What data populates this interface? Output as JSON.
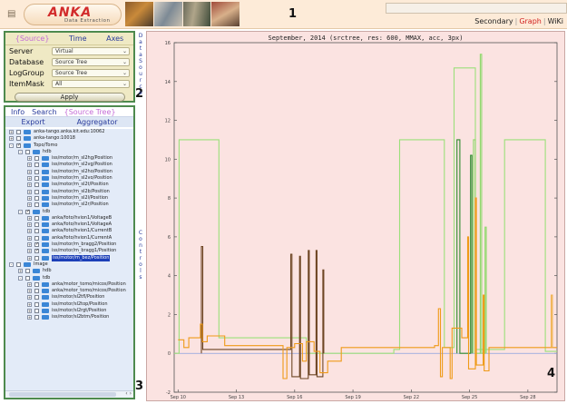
{
  "header": {
    "logo_text": "ANKA",
    "logo_subtitle": "Data Extraction",
    "view_links": [
      {
        "label": "Secondary",
        "active": false
      },
      {
        "label": "Graph",
        "active": true
      },
      {
        "label": "WiKi",
        "active": false
      }
    ]
  },
  "markers": [
    "1",
    "2",
    "3",
    "4"
  ],
  "source_panel": {
    "tabs": [
      {
        "label": "{Source}",
        "selected": true
      },
      {
        "label": "Time",
        "selected": false
      },
      {
        "label": "Axes",
        "selected": false
      }
    ],
    "fields": [
      {
        "label": "Server",
        "value": "Virtual"
      },
      {
        "label": "Database",
        "value": "Source Tree"
      },
      {
        "label": "LogGroup",
        "value": "Source Tree"
      },
      {
        "label": "ItemMask",
        "value": "All"
      }
    ],
    "apply_label": "Apply",
    "strip_label": "Data Source"
  },
  "tree_panel": {
    "tabs_row1": [
      {
        "label": "Info",
        "selected": false
      },
      {
        "label": "Search",
        "selected": false
      },
      {
        "label": "{Source Tree}",
        "selected": true
      }
    ],
    "tabs_row2": [
      {
        "label": "Export",
        "selected": false
      },
      {
        "label": "Aggregator",
        "selected": false
      }
    ],
    "controls_strip": "Controls",
    "scroll_glyph": "‹ ›",
    "items": [
      {
        "level": 0,
        "toggle": "+",
        "checked": false,
        "label": "anka-tango.anka.kit.edu:10062"
      },
      {
        "level": 0,
        "toggle": "+",
        "checked": false,
        "label": "anka-tango:10018"
      },
      {
        "level": 0,
        "toggle": "-",
        "checked": true,
        "label": "Topo/Tomo"
      },
      {
        "level": 1,
        "toggle": "-",
        "checked": false,
        "label": "hdb"
      },
      {
        "level": 2,
        "toggle": "+",
        "checked": false,
        "label": "iss/motor/m_sl2hg/Position"
      },
      {
        "level": 2,
        "toggle": "+",
        "checked": false,
        "label": "iss/motor/m_sl2vg/Position"
      },
      {
        "level": 2,
        "toggle": "+",
        "checked": false,
        "label": "iss/motor/m_sl2ho/Position"
      },
      {
        "level": 2,
        "toggle": "+",
        "checked": false,
        "label": "iss/motor/m_sl2vo/Position"
      },
      {
        "level": 2,
        "toggle": "+",
        "checked": false,
        "label": "iss/motor/m_sl2t/Position"
      },
      {
        "level": 2,
        "toggle": "+",
        "checked": false,
        "label": "iss/motor/m_sl2b/Position"
      },
      {
        "level": 2,
        "toggle": "+",
        "checked": false,
        "label": "iss/motor/m_sl2l/Position"
      },
      {
        "level": 2,
        "toggle": "+",
        "checked": false,
        "label": "iss/motor/m_sl2r/Position"
      },
      {
        "level": 1,
        "toggle": "-",
        "checked": true,
        "label": "tdb"
      },
      {
        "level": 2,
        "toggle": "+",
        "checked": false,
        "label": "anka/foto/hvion1/VoltageB"
      },
      {
        "level": 2,
        "toggle": "+",
        "checked": false,
        "label": "anka/foto/hvion1/VoltageA"
      },
      {
        "level": 2,
        "toggle": "+",
        "checked": false,
        "label": "anka/foto/hvion1/CurrentB"
      },
      {
        "level": 2,
        "toggle": "+",
        "checked": false,
        "label": "anka/foto/hvion1/CurrentA"
      },
      {
        "level": 2,
        "toggle": "+",
        "checked": true,
        "label": "iss/motor/m_bragg2/Position"
      },
      {
        "level": 2,
        "toggle": "+",
        "checked": true,
        "label": "iss/motor/m_bragg1/Position"
      },
      {
        "level": 2,
        "toggle": "+",
        "checked": false,
        "label": "iss/motor/m_bez/Position",
        "highlighted": true
      },
      {
        "level": 0,
        "toggle": "-",
        "checked": false,
        "label": "Image"
      },
      {
        "level": 1,
        "toggle": "+",
        "checked": false,
        "label": "hdb"
      },
      {
        "level": 1,
        "toggle": "-",
        "checked": false,
        "label": "tdb"
      },
      {
        "level": 2,
        "toggle": "+",
        "checked": false,
        "label": "anka/motor_tomo/micos/Position"
      },
      {
        "level": 2,
        "toggle": "+",
        "checked": false,
        "label": "anka/motor_tomo/micos/Position"
      },
      {
        "level": 2,
        "toggle": "+",
        "checked": false,
        "label": "iss/motor/sl2tfl/Position"
      },
      {
        "level": 2,
        "toggle": "+",
        "checked": false,
        "label": "iss/motor/sl2top/Position"
      },
      {
        "level": 2,
        "toggle": "+",
        "checked": false,
        "label": "iss/motor/sl2rgt/Position"
      },
      {
        "level": 2,
        "toggle": "+",
        "checked": false,
        "label": "iss/motor/sl2btm/Position"
      }
    ]
  },
  "chart_data": {
    "type": "line",
    "title": "September, 2014 (srctree, res: 600, MMAX, acc, 3px)",
    "xlabel": "",
    "ylabel": "",
    "x_ticks": [
      "Sep 10",
      "Sep 13",
      "Sep 16",
      "Sep 19",
      "Sep 22",
      "Sep 25",
      "Sep 28"
    ],
    "x_tick_days": [
      10,
      13,
      16,
      19,
      22,
      25,
      28
    ],
    "xlim": [
      9.8,
      29.5
    ],
    "y_ticks": [
      -2,
      0,
      2,
      4,
      6,
      8,
      10,
      12,
      14,
      16
    ],
    "ylim": [
      -2,
      16
    ],
    "grid": false,
    "series": [
      {
        "color": "#9be07a",
        "points": [
          [
            9.8,
            0
          ],
          [
            10.05,
            0
          ],
          [
            10.05,
            11
          ],
          [
            12.1,
            11
          ],
          [
            12.1,
            0.8
          ],
          [
            16.6,
            0.8
          ],
          [
            16.6,
            0
          ],
          [
            21.1,
            0
          ],
          [
            21.1,
            0.2
          ],
          [
            21.4,
            0.2
          ],
          [
            21.4,
            11
          ],
          [
            23.7,
            11
          ],
          [
            23.7,
            0.3
          ],
          [
            24.2,
            0.3
          ],
          [
            24.2,
            14.7
          ],
          [
            25.3,
            14.7
          ],
          [
            25.3,
            0.2
          ],
          [
            26.8,
            0.2
          ],
          [
            26.8,
            11
          ],
          [
            28.9,
            11
          ],
          [
            28.9,
            0.1
          ],
          [
            29.5,
            0.1
          ]
        ]
      },
      {
        "color": "#2e8b2e",
        "points": [
          [
            24.35,
            0
          ],
          [
            24.35,
            11
          ],
          [
            24.5,
            11
          ],
          [
            24.5,
            0
          ],
          [
            25.05,
            0
          ],
          [
            25.05,
            10.2
          ],
          [
            25.12,
            10.2
          ],
          [
            25.12,
            0
          ]
        ]
      },
      {
        "color": "#8fd96a",
        "points": [
          [
            25.2,
            0
          ],
          [
            25.2,
            11
          ],
          [
            25.3,
            11
          ],
          [
            25.3,
            0
          ],
          [
            25.55,
            0
          ],
          [
            25.55,
            15.4
          ],
          [
            25.62,
            15.4
          ],
          [
            25.62,
            0
          ],
          [
            25.8,
            0
          ],
          [
            25.8,
            6.5
          ],
          [
            25.86,
            6.5
          ],
          [
            25.86,
            0
          ]
        ]
      },
      {
        "color": "#6e4624",
        "points": [
          [
            11.2,
            0
          ],
          [
            11.2,
            5.5
          ],
          [
            11.27,
            5.5
          ],
          [
            11.27,
            0.2
          ],
          [
            15.8,
            0.2
          ],
          [
            15.8,
            5.1
          ],
          [
            15.86,
            5.1
          ],
          [
            15.86,
            -1.2
          ],
          [
            16.25,
            -1.2
          ],
          [
            16.25,
            5.0
          ],
          [
            16.3,
            5.0
          ],
          [
            16.3,
            -1.3
          ],
          [
            16.7,
            -1.3
          ],
          [
            16.7,
            5.3
          ],
          [
            16.75,
            5.3
          ],
          [
            16.75,
            -1.1
          ],
          [
            17.1,
            -1.1
          ],
          [
            17.1,
            5.3
          ],
          [
            17.15,
            5.3
          ],
          [
            17.15,
            -1.2
          ],
          [
            17.45,
            -1.2
          ],
          [
            17.45,
            4.3
          ],
          [
            17.5,
            4.3
          ],
          [
            17.5,
            0
          ]
        ]
      },
      {
        "color": "#ef9a18",
        "points": [
          [
            10.0,
            0.7
          ],
          [
            10.3,
            0.7
          ],
          [
            10.3,
            0.3
          ],
          [
            10.55,
            0.3
          ],
          [
            10.55,
            0.8
          ],
          [
            11.15,
            0.8
          ],
          [
            11.15,
            1.5
          ],
          [
            11.25,
            1.5
          ],
          [
            11.25,
            0.6
          ],
          [
            11.5,
            0.6
          ],
          [
            11.5,
            0.9
          ],
          [
            12.4,
            0.9
          ],
          [
            12.4,
            0.4
          ],
          [
            15.4,
            0.4
          ],
          [
            15.4,
            -1.3
          ],
          [
            15.6,
            -1.3
          ],
          [
            15.6,
            0.3
          ],
          [
            16.0,
            0.3
          ],
          [
            16.0,
            0.5
          ],
          [
            16.4,
            0.5
          ],
          [
            16.4,
            -0.4
          ],
          [
            16.6,
            -0.4
          ],
          [
            16.6,
            0.6
          ],
          [
            17.0,
            0.6
          ],
          [
            17.0,
            0.1
          ],
          [
            17.3,
            0.1
          ],
          [
            17.3,
            -1.0
          ],
          [
            17.7,
            -1.0
          ],
          [
            17.7,
            -0.4
          ],
          [
            18.4,
            -0.4
          ],
          [
            18.4,
            0.3
          ],
          [
            23.2,
            0.3
          ],
          [
            23.2,
            0.4
          ],
          [
            23.4,
            0.4
          ],
          [
            23.4,
            2.3
          ],
          [
            23.5,
            2.3
          ],
          [
            23.5,
            -1.2
          ],
          [
            23.6,
            -1.2
          ],
          [
            23.6,
            0.3
          ],
          [
            24.0,
            0.3
          ],
          [
            24.0,
            -1.3
          ],
          [
            24.1,
            -1.3
          ],
          [
            24.1,
            1.3
          ],
          [
            24.6,
            1.3
          ],
          [
            24.6,
            0.8
          ],
          [
            24.9,
            0.8
          ],
          [
            24.9,
            6.0
          ],
          [
            24.95,
            6.0
          ],
          [
            24.95,
            -0.8
          ],
          [
            25.3,
            -0.8
          ],
          [
            25.3,
            8.0
          ],
          [
            25.35,
            8.0
          ],
          [
            25.35,
            -0.6
          ],
          [
            25.7,
            -0.6
          ],
          [
            25.7,
            3.0
          ],
          [
            25.75,
            3.0
          ],
          [
            25.75,
            -0.9
          ],
          [
            26.0,
            -0.9
          ],
          [
            26.0,
            0.3
          ],
          [
            29.5,
            0.3
          ]
        ]
      },
      {
        "color": "#f0b24a",
        "points": [
          [
            29.2,
            0.3
          ],
          [
            29.2,
            3.0
          ],
          [
            29.26,
            3.0
          ],
          [
            29.26,
            0.3
          ]
        ]
      }
    ]
  }
}
